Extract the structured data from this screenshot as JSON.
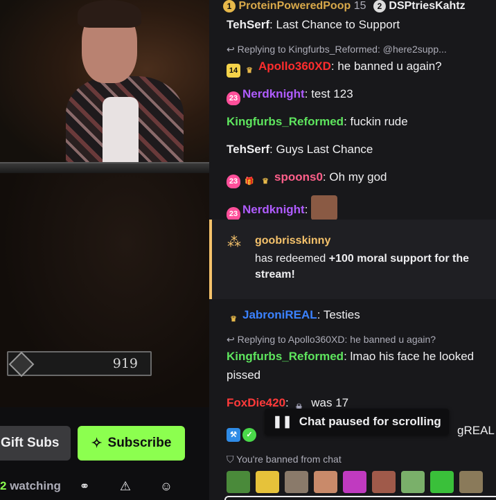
{
  "leaderboard": [
    {
      "rank": "1",
      "name": "ProteinPoweredPoop",
      "count": "15"
    },
    {
      "rank": "2",
      "name": "DSPtriesKahtz"
    }
  ],
  "stream": {
    "hud_value": "919",
    "gift_label": "Gift Subs",
    "subscribe_label": "Subscribe",
    "watching": "watching",
    "watching_prefix": "2"
  },
  "chat": {
    "messages": [
      {
        "user": "TehSerf",
        "color": "#ffffff",
        "text": "Last Chance to Support"
      },
      {
        "reply": "Replying to Kingfurbs_Reformed: @here2supp...",
        "badge": "14",
        "user": "Apollo360XD",
        "color": "#ff2d2d",
        "text": "he banned u again?"
      },
      {
        "badge": "23",
        "user": "Nerdknight",
        "color": "#b05cff",
        "text": "test 123"
      },
      {
        "user": "Kingfurbs_Reformed",
        "color": "#5ee55e",
        "text": "fuckin rude"
      },
      {
        "user": "TehSerf",
        "color": "#ffffff",
        "text": "Guys Last Chance"
      },
      {
        "badge": "23",
        "user": "spoons0",
        "color": "#ff5f8a",
        "text": "Oh my god"
      },
      {
        "badge": "23",
        "user": "Nerdknight",
        "color": "#b05cff",
        "text": ""
      },
      {
        "user": "JabroniREAL",
        "color": "#3b82ff",
        "text": "Testies"
      },
      {
        "reply": "Replying to Apollo360XD: he banned u again?",
        "user": "Kingfurbs_Reformed",
        "color": "#5ee55e",
        "text": "lmao his face he looked pissed"
      },
      {
        "user": "FoxDie420",
        "color": "#ff3a3a",
        "text": "was 17"
      },
      {
        "text": "gREAL"
      }
    ],
    "redeem": {
      "user": "goobrisskinny",
      "prefix": "has redeemed",
      "reward": "+100 moral support for the stream!"
    },
    "paused": "Chat paused for scrolling",
    "banned": "You're banned from chat"
  }
}
